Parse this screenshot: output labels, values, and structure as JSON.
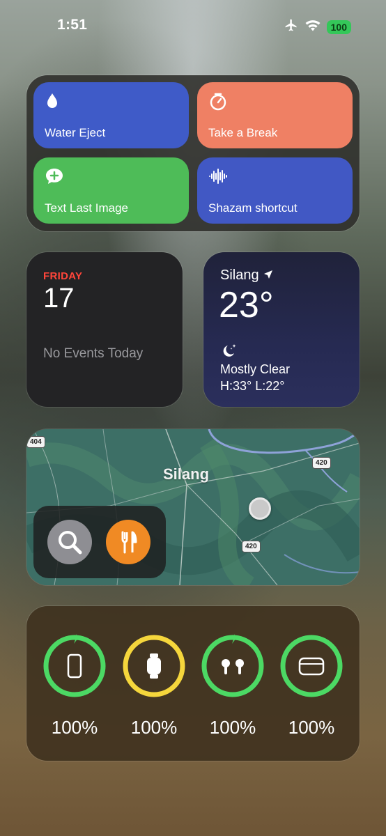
{
  "status": {
    "time": "1:51",
    "battery": "100",
    "icons": [
      "airplane-icon",
      "wifi-icon"
    ]
  },
  "shortcuts": [
    {
      "label": "Water Eject",
      "icon": "water-drop-icon",
      "color": "#3f5bc8"
    },
    {
      "label": "Take a Break",
      "icon": "timer-icon",
      "color": "#ef8064"
    },
    {
      "label": "Text Last Image",
      "icon": "message-plus-icon",
      "color": "#4ebc58"
    },
    {
      "label": "Shazam shortcut",
      "icon": "waveform-icon",
      "color": "#4158c4"
    }
  ],
  "calendar": {
    "weekday": "FRIDAY",
    "date": "17",
    "events": "No Events Today"
  },
  "weather": {
    "location": "Silang",
    "temperature": "23°",
    "condition": "Mostly Clear",
    "high_low": "H:33° L:22°",
    "icon": "moon-stars-icon"
  },
  "map": {
    "title": "Silang",
    "road_labels": [
      "404",
      "420",
      "420"
    ],
    "buttons": [
      {
        "name": "search-button",
        "icon": "search-icon",
        "color": "#8e8e93"
      },
      {
        "name": "restaurants-button",
        "icon": "fork-knife-icon",
        "color": "#f08a24"
      }
    ]
  },
  "batteries": [
    {
      "device": "iphone",
      "percent": "100%",
      "level": 1.0,
      "charging": true,
      "ring_color": "#4cd964"
    },
    {
      "device": "apple-watch",
      "percent": "100%",
      "level": 1.0,
      "charging": false,
      "ring_color": "#f5d63c"
    },
    {
      "device": "airpods",
      "percent": "100%",
      "level": 1.0,
      "charging": true,
      "ring_color": "#4cd964"
    },
    {
      "device": "airpods-case",
      "percent": "100%",
      "level": 1.0,
      "charging": false,
      "ring_color": "#4cd964"
    }
  ]
}
